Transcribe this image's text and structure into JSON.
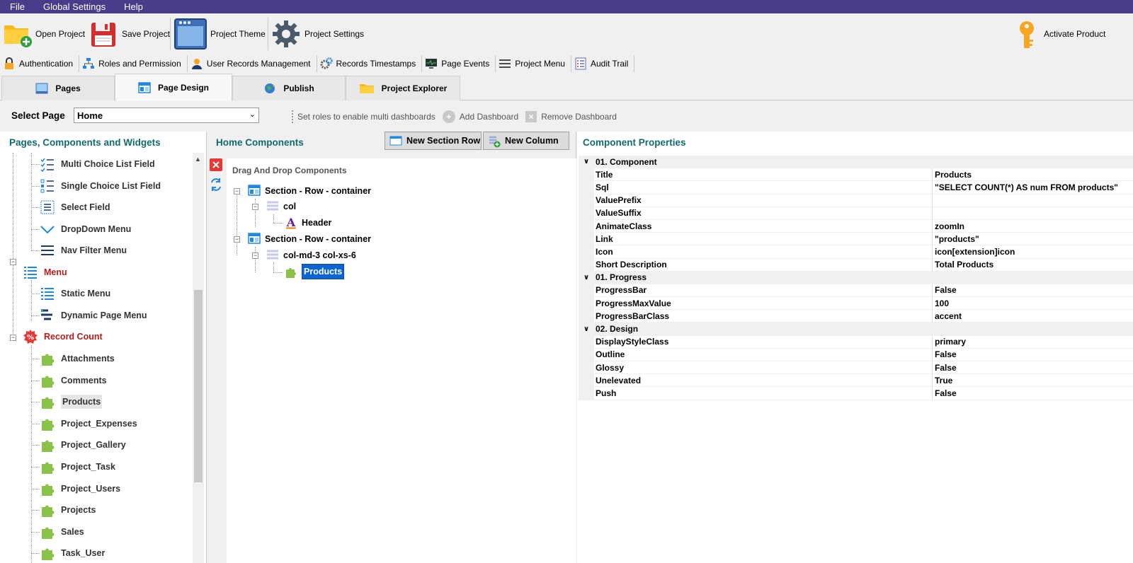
{
  "menubar": {
    "items": [
      "File",
      "Global Settings",
      "Help"
    ]
  },
  "toolbar": {
    "open_project": "Open Project",
    "save_project": "Save Project",
    "project_theme": "Project Theme",
    "project_settings": "Project Settings",
    "activate_product": "Activate Product"
  },
  "toolbar2": {
    "items": [
      "Authentication",
      "Roles and Permission",
      "User Records Management",
      "Records Timestamps",
      "Page Events",
      "Project Menu",
      "Audit Trail"
    ]
  },
  "tabs": {
    "items": [
      "Pages",
      "Page Design",
      "Publish",
      "Project Explorer"
    ],
    "active": "Page Design"
  },
  "select_page": {
    "label": "Select Page",
    "value": "Home",
    "roles_hint": "Set roles to enable multi dashboards",
    "add_dashboard": "Add Dashboard",
    "remove_dashboard": "Remove Dashboard"
  },
  "left_panel": {
    "title": "Pages, Components and Widgets",
    "items": [
      "Multi Choice List Field",
      "Single Choice List Field",
      "Select Field",
      "DropDown Menu",
      "Nav Filter Menu",
      "Menu",
      "Static Menu",
      "Dynamic Page Menu",
      "Record Count",
      "Attachments",
      "Comments",
      "Products",
      "Project_Expenses",
      "Project_Gallery",
      "Project_Task",
      "Project_Users",
      "Projects",
      "Sales",
      "Task_User"
    ]
  },
  "mid_panel": {
    "title": "Home Components",
    "new_section_row": "New Section Row",
    "new_column": "New Column",
    "drag_drop_label": "Drag And Drop Components",
    "tree": [
      "Section - Row - container",
      "col",
      "Header",
      "Section - Row - container",
      "col-md-3 col-xs-6",
      "Products"
    ]
  },
  "right_panel": {
    "title": "Component Properties",
    "groups": [
      {
        "name": "01. Component",
        "rows": [
          [
            "Title",
            "Products"
          ],
          [
            "Sql",
            "\"SELECT COUNT(*) AS num FROM products\""
          ],
          [
            "ValuePrefix",
            ""
          ],
          [
            "ValueSuffix",
            ""
          ],
          [
            "AnimateClass",
            "zoomIn"
          ],
          [
            "Link",
            "\"products\""
          ],
          [
            "Icon",
            "icon[extension]icon"
          ],
          [
            "Short Description",
            "Total Products"
          ]
        ]
      },
      {
        "name": "01. Progress",
        "rows": [
          [
            "ProgressBar",
            "False"
          ],
          [
            "ProgressMaxValue",
            "100"
          ],
          [
            "ProgressBarClass",
            "accent"
          ]
        ]
      },
      {
        "name": "02. Design",
        "rows": [
          [
            "DisplayStyleClass",
            "primary"
          ],
          [
            "Outline",
            "False"
          ],
          [
            "Glossy",
            "False"
          ],
          [
            "Unelevated",
            "True"
          ],
          [
            "Push",
            "False"
          ]
        ]
      }
    ]
  },
  "colors": {
    "menubar": "#483d8b",
    "panel_title": "#0f6b70",
    "category_red": "#b71c1c",
    "selection": "#0a64d6",
    "widget_green": "#8bc34a"
  }
}
